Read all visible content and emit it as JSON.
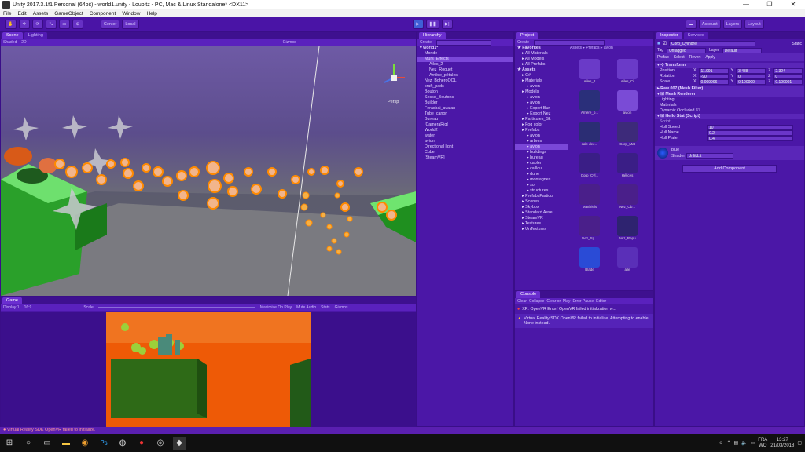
{
  "window": {
    "title": "Unity 2017.3.1f1 Personal (64bit) - world1.unity - Loubitz - PC, Mac & Linux Standalone* <DX11>",
    "min": "—",
    "max": "❐",
    "close": "✕"
  },
  "menu": [
    "File",
    "Edit",
    "Assets",
    "GameObject",
    "Component",
    "Window",
    "Help"
  ],
  "toolbar": {
    "tools": [
      "✋",
      "✥",
      "⟳",
      "⤡",
      "▭",
      "⊕"
    ],
    "pivot": "Center",
    "space": "Local",
    "play": "▶",
    "pause": "❚❚",
    "step": "▶|",
    "account": "Account",
    "layers": "Layers",
    "layout": "Layout"
  },
  "scene": {
    "tabs": [
      "Scene",
      "Lighting"
    ],
    "shading": "Shaded",
    "mode": "2D",
    "gizmos": "Gizmos",
    "persp": "Persp"
  },
  "game": {
    "tabs": [
      "Game"
    ],
    "display": "Display 1",
    "aspect": "16:9",
    "scale": "Scale",
    "options": [
      "Maximize On Play",
      "Mute Audio",
      "Stats",
      "Gizmos"
    ]
  },
  "hierarchy": {
    "title": "Hierarchy",
    "create": "Create",
    "scene": "world1*",
    "items": [
      {
        "label": "Monde",
        "indent": 1
      },
      {
        "label": "Murs_Effects",
        "indent": 1,
        "selected": true
      },
      {
        "label": "Ailes_2",
        "indent": 2
      },
      {
        "label": "Nez_Roquet",
        "indent": 2
      },
      {
        "label": "Arrière_pétales",
        "indent": 2
      },
      {
        "label": "Nez_BoheroOOL",
        "indent": 1
      },
      {
        "label": "craft_pads",
        "indent": 1
      },
      {
        "label": "Bouton",
        "indent": 1
      },
      {
        "label": "Sesse_Boutons",
        "indent": 1
      },
      {
        "label": "Builder",
        "indent": 1
      },
      {
        "label": "Ferasbai_avalan",
        "indent": 1
      },
      {
        "label": "Tube_canon",
        "indent": 1
      },
      {
        "label": "Bureau",
        "indent": 1
      },
      {
        "label": "[CameraRig]",
        "indent": 1
      },
      {
        "label": "World2",
        "indent": 1
      },
      {
        "label": "water",
        "indent": 1
      },
      {
        "label": "avion",
        "indent": 1
      },
      {
        "label": "Directional light",
        "indent": 1
      },
      {
        "label": "Cube",
        "indent": 1
      },
      {
        "label": "[SteamVR]",
        "indent": 1
      }
    ]
  },
  "project": {
    "title": "Project",
    "create": "Create",
    "path": [
      "Assets",
      "Prefabs",
      "avion"
    ],
    "tree": [
      {
        "label": "Favorites",
        "indent": 0,
        "bold": true
      },
      {
        "label": "All Materials",
        "indent": 1
      },
      {
        "label": "All Models",
        "indent": 1
      },
      {
        "label": "All Prefabs",
        "indent": 1
      },
      {
        "label": "Assets",
        "indent": 0,
        "bold": true
      },
      {
        "label": "C#",
        "indent": 1
      },
      {
        "label": "Materials",
        "indent": 1
      },
      {
        "label": "avion",
        "indent": 2
      },
      {
        "label": "Models",
        "indent": 1
      },
      {
        "label": "avion",
        "indent": 2
      },
      {
        "label": "avion",
        "indent": 2
      },
      {
        "label": "Export Bun",
        "indent": 2
      },
      {
        "label": "Export Nez",
        "indent": 2
      },
      {
        "label": "Particules_Sk",
        "indent": 1
      },
      {
        "label": "Fog color",
        "indent": 1
      },
      {
        "label": "Prefabs",
        "indent": 1
      },
      {
        "label": "avion",
        "indent": 2
      },
      {
        "label": "arbres",
        "indent": 2
      },
      {
        "label": "avion",
        "indent": 2,
        "selected": true
      },
      {
        "label": "buildings",
        "indent": 2
      },
      {
        "label": "bureau",
        "indent": 2
      },
      {
        "label": "cabler",
        "indent": 2
      },
      {
        "label": "caillou",
        "indent": 2
      },
      {
        "label": "dune",
        "indent": 2
      },
      {
        "label": "montagnes",
        "indent": 2
      },
      {
        "label": "sol",
        "indent": 2
      },
      {
        "label": "structures",
        "indent": 2
      },
      {
        "label": "PrefabsParticu",
        "indent": 1
      },
      {
        "label": "Scenes",
        "indent": 1
      },
      {
        "label": "Skybox",
        "indent": 1
      },
      {
        "label": "Standard Asse",
        "indent": 1
      },
      {
        "label": "SteamVR",
        "indent": 1
      },
      {
        "label": "Textures",
        "indent": 1
      },
      {
        "label": "UnTextures",
        "indent": 1
      }
    ],
    "assets": [
      {
        "label": "Ailes_2",
        "color": "#6a3ac8"
      },
      {
        "label": "Ailes_Ci",
        "color": "#6a3ac8"
      },
      {
        "label": "Arrière_p...",
        "color": "#2a2f7a"
      },
      {
        "label": "avion",
        "color": "#7a4bd6"
      },
      {
        "label": "cale dee...",
        "color": "#2b2d74"
      },
      {
        "label": "Corp_Mat",
        "color": "#3d2a7a"
      },
      {
        "label": "Corp_Cyl...",
        "color": "#3a1e86"
      },
      {
        "label": "Hélices",
        "color": "#3a1e86"
      },
      {
        "label": "Matériels",
        "color": "#4a1f8a"
      },
      {
        "label": "Nez_Ob...",
        "color": "#4a1f8a"
      },
      {
        "label": "Nez_Sp...",
        "color": "#4a1f8a"
      },
      {
        "label": "Nez_Repu",
        "color": "#2e2370"
      },
      {
        "label": "Blade",
        "color": "#2a4bd6"
      },
      {
        "label": "aile",
        "color": "#5a2fb8"
      }
    ]
  },
  "console": {
    "title": "Console",
    "buttons": [
      "Clear",
      "Collapse",
      "Clear on Play",
      "Error Pause",
      "Editor"
    ],
    "messages": [
      "XR: OpenVR Error! OpenVR failed initialization w...",
      "Virtual Reality SDK OpenVR failed to initialize. Attempting to enable None instead."
    ]
  },
  "inspector": {
    "tabs": [
      "Inspector",
      "Services"
    ],
    "object_name": "Corp_Cylindre",
    "static": "Static",
    "tag_label": "Tag",
    "tag": "Untagged",
    "layer_label": "Layer",
    "layer": "Default",
    "prefab_buttons": [
      "Prefab",
      "Select",
      "Revert",
      "Apply"
    ],
    "transform": {
      "title": "Transform",
      "rows": [
        {
          "label": "Position",
          "x": "11.991",
          "y": "3.488",
          "z": "2.324"
        },
        {
          "label": "Rotation",
          "x": "-90",
          "y": "0",
          "z": "0"
        },
        {
          "label": "Scale",
          "x": "0.099996",
          "y": "0.100000",
          "z": "0.100001"
        }
      ]
    },
    "components": [
      "Raw 007 (Mesh Filter)",
      "Mesh Renderer",
      "Lighting",
      "Materials",
      "Dynamic Occluded"
    ],
    "script": {
      "title": "Hello Stat (Script)",
      "script_label": "Script",
      "rows": [
        {
          "label": "Hull Speed",
          "value": "10"
        },
        {
          "label": "Hull Name",
          "value": "0.2"
        },
        {
          "label": "Hull Plate",
          "value": "0.4"
        }
      ]
    },
    "material": {
      "name": "blue",
      "shader_label": "Shader",
      "shader": "Unlit/Lit"
    },
    "add_component": "Add Component"
  },
  "status": "Virtual Reality SDK OpenVR failed to initialize.",
  "taskbar": {
    "lang": "FRA",
    "lang2": "WO",
    "time": "13:27",
    "date": "21/03/2018"
  },
  "colors": {
    "accent": "#5a1fb0",
    "panel": "#4b17a7",
    "orange": "#ff7a00"
  }
}
